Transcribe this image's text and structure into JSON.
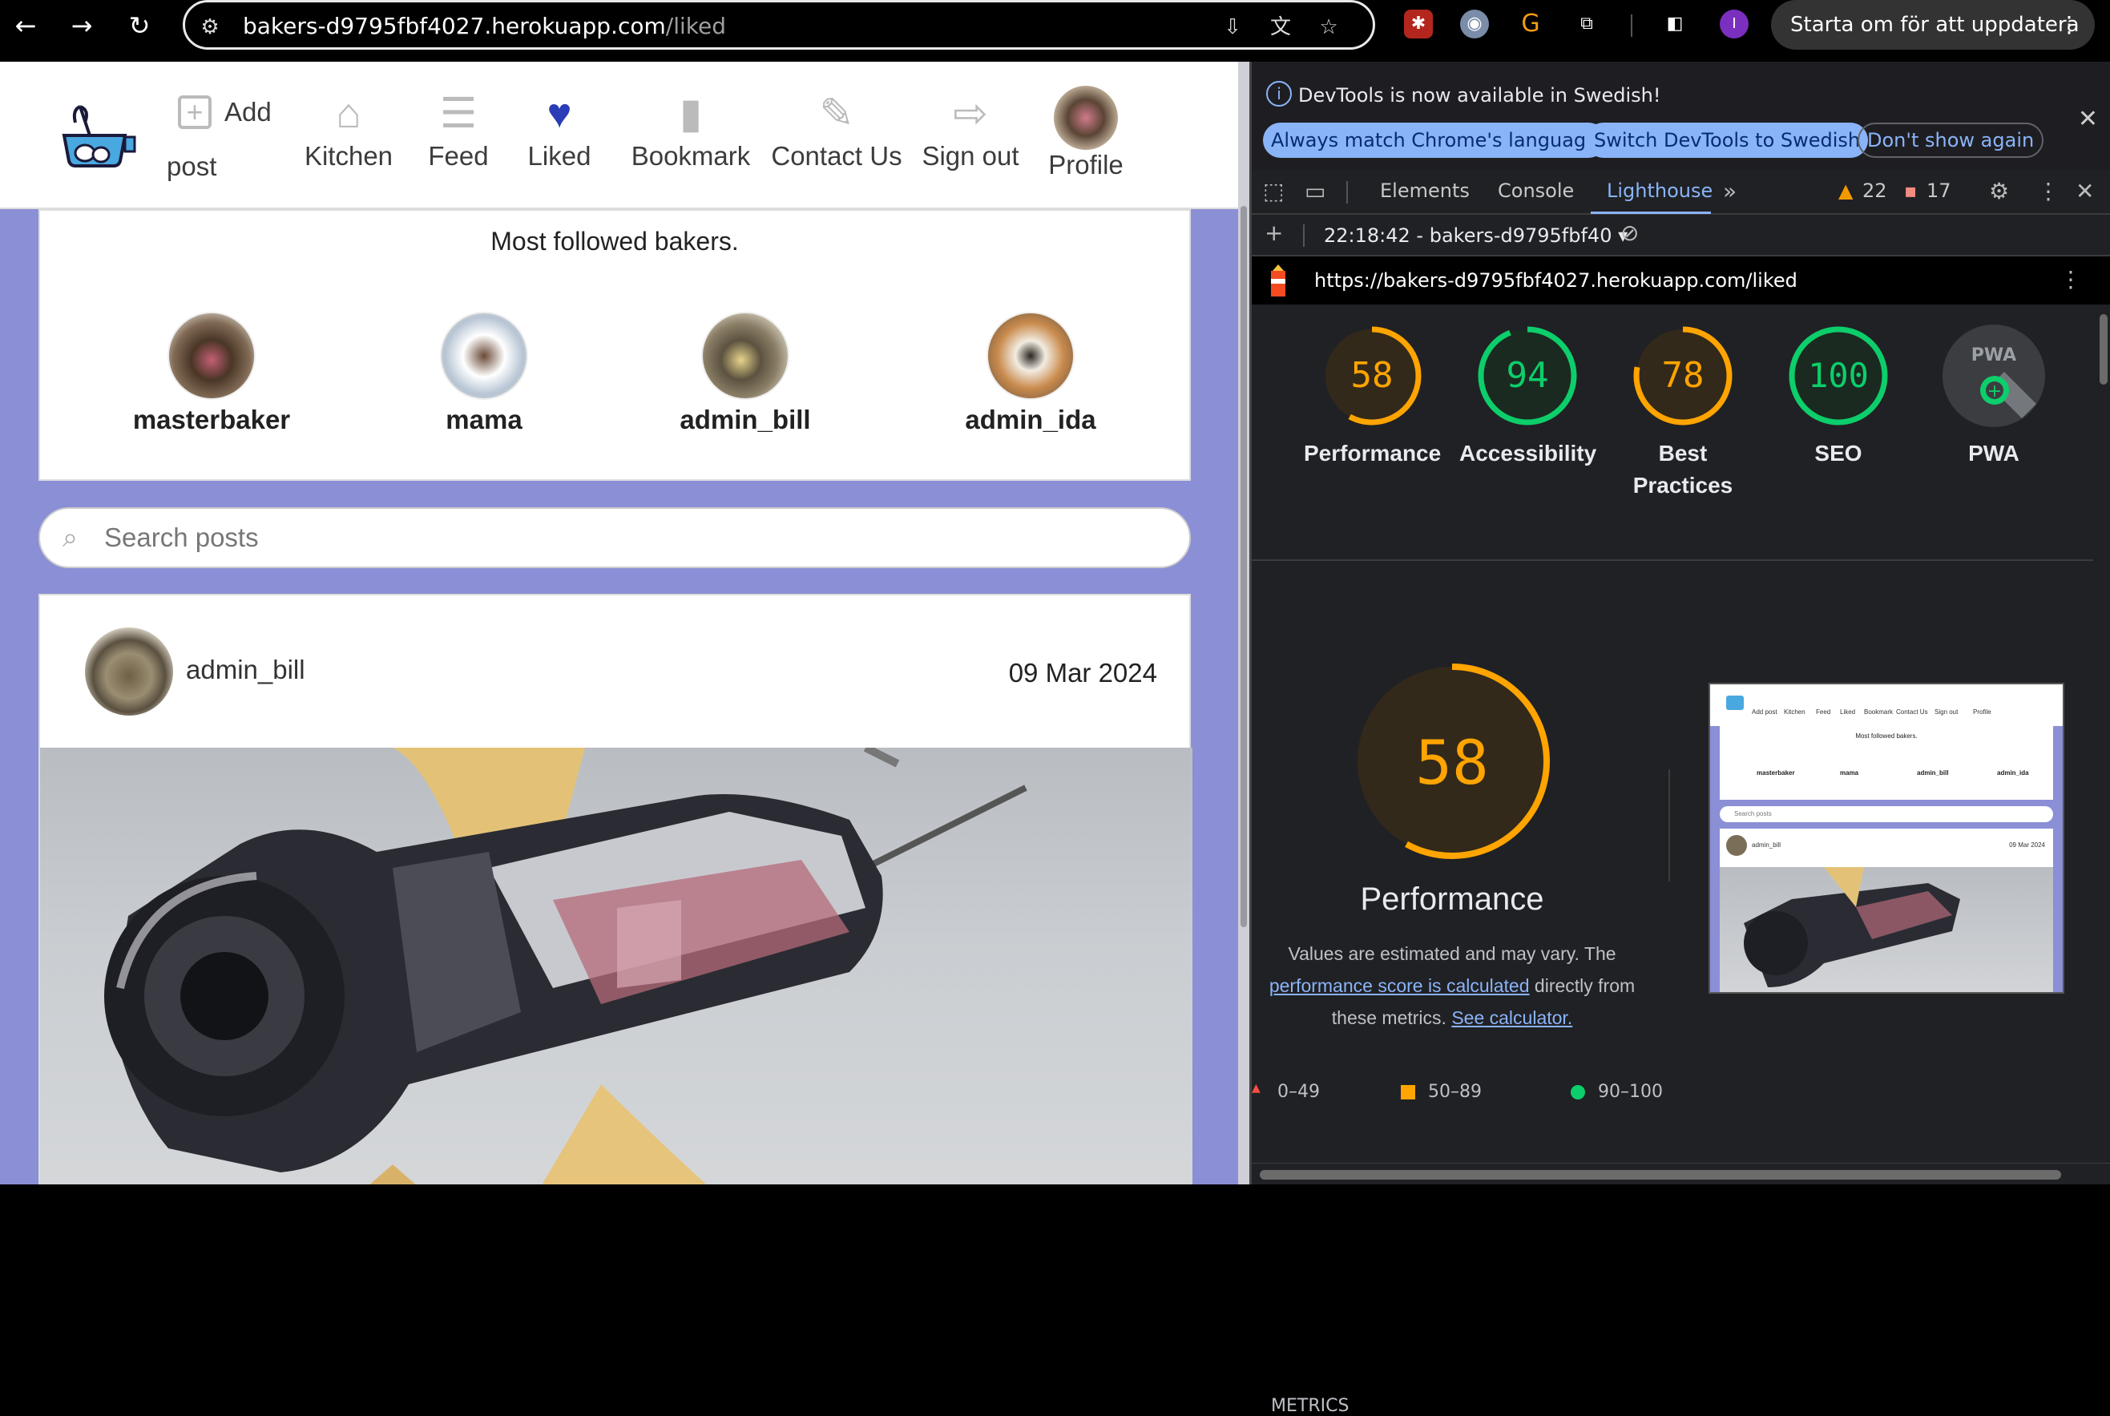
{
  "browser": {
    "url_host": "bakers-d9795fbf4027.herokuapp.com",
    "url_path": "/liked",
    "update_button": "Starta om för att uppdatera",
    "profile_initial": "I"
  },
  "site_nav": {
    "add_post_line1": "Add",
    "add_post_line2": "post",
    "items": [
      {
        "label": "Kitchen",
        "icon": "home-icon"
      },
      {
        "label": "Feed",
        "icon": "feed-icon"
      },
      {
        "label": "Liked",
        "icon": "heart-icon"
      },
      {
        "label": "Bookmark",
        "icon": "bookmark-icon"
      },
      {
        "label": "Contact Us",
        "icon": "pencil-icon"
      },
      {
        "label": "Sign out",
        "icon": "sign-out-icon"
      },
      {
        "label": "Profile",
        "icon": "avatar"
      }
    ],
    "active_color": "#2a3cb6"
  },
  "followed": {
    "title": "Most followed bakers.",
    "bakers": [
      "masterbaker",
      "mama",
      "admin_bill",
      "admin_ida"
    ]
  },
  "search": {
    "placeholder": "Search posts"
  },
  "post": {
    "author": "admin_bill",
    "date": "09 Mar 2024"
  },
  "devtools": {
    "info_text": "DevTools is now available in Swedish!",
    "info_btn_1": "Always match Chrome's language",
    "info_btn_2": "Switch DevTools to Swedish",
    "info_btn_3": "Don't show again",
    "tabs": [
      "Elements",
      "Console",
      "Lighthouse"
    ],
    "active_tab": "Lighthouse",
    "warnings": "22",
    "issues": "17",
    "report_session": "22:18:42 - bakers-d9795fbf40",
    "report_url": "https://bakers-d9795fbf4027.herokuapp.com/liked"
  },
  "lighthouse": {
    "scores": [
      {
        "name": "Performance",
        "value": "58",
        "color": "#ffa400"
      },
      {
        "name": "Accessibility",
        "value": "94",
        "color": "#0cce6b"
      },
      {
        "name": "Best Practices",
        "value": "78",
        "color": "#ffa400"
      },
      {
        "name": "SEO",
        "value": "100",
        "color": "#0cce6b"
      },
      {
        "name": "PWA",
        "value": "",
        "color": "#9aa0a6"
      }
    ],
    "main_score": "58",
    "main_title": "Performance",
    "desc_part1": "Values are estimated and may vary. The",
    "desc_link1": "performance score is calculated",
    "desc_part2": "directly from these metrics.",
    "desc_link2": "See calculator.",
    "legend": [
      "0–49",
      "50–89",
      "90–100"
    ],
    "thumb": {
      "nav": [
        "Add post",
        "Kitchen",
        "Feed",
        "Liked",
        "Bookmark",
        "Contact Us",
        "Sign out",
        "Profile"
      ],
      "title": "Most followed bakers.",
      "bakers": [
        "masterbaker",
        "mama",
        "admin_bill",
        "admin_ida"
      ],
      "search": "Search posts",
      "author": "admin_bill",
      "date": "09 Mar 2024"
    },
    "metrics_peek": "METRICS"
  }
}
